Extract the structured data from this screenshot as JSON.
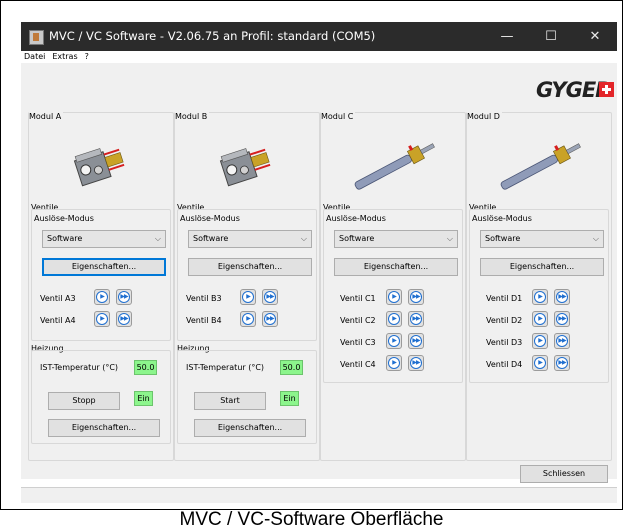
{
  "window": {
    "title": "MVC / VC Software - V2.06.75 an Profil: standard (COM5)",
    "minimize_glyph": "—",
    "maximize_glyph": "☐",
    "close_glyph": "✕"
  },
  "menu": [
    "Datei",
    "Extras",
    "?"
  ],
  "logo": {
    "text": "GYGER"
  },
  "labels": {
    "ventile": "Ventile",
    "ausloese_modus": "Auslöse-Modus",
    "eigenschaften": "Eigenschaften...",
    "heizung": "Heizung",
    "ist_temp": "IST-Temperatur (°C)"
  },
  "modules": [
    {
      "name": "Modul A",
      "mode": "Software",
      "image": "heated-valve-module-image",
      "valves": [
        "Ventil A3",
        "Ventil A4"
      ],
      "heating": {
        "temp": "50.0",
        "button": "Stopp",
        "status": "Ein"
      }
    },
    {
      "name": "Modul B",
      "mode": "Software",
      "image": "heated-valve-module-image",
      "valves": [
        "Ventil B3",
        "Ventil B4"
      ],
      "heating": {
        "temp": "50.0",
        "button": "Start",
        "status": "Ein"
      }
    },
    {
      "name": "Modul C",
      "mode": "Software",
      "image": "needle-valve-image",
      "valves": [
        "Ventil C1",
        "Ventil C2",
        "Ventil C3",
        "Ventil C4"
      ]
    },
    {
      "name": "Modul D",
      "mode": "Software",
      "image": "needle-valve-image",
      "valves": [
        "Ventil D1",
        "Ventil D2",
        "Ventil D3",
        "Ventil D4"
      ]
    }
  ],
  "icons": {
    "single_shot": "play-icon",
    "continuous": "fast-forward-icon"
  },
  "close_button": "Schliessen",
  "caption": "MVC / VC-Software Oberfläche",
  "colors": {
    "titlebar": "#2b2b2b",
    "indicator_green": "#8cf58c",
    "focus_blue": "#0078d7",
    "logo_red": "#e3262a"
  }
}
